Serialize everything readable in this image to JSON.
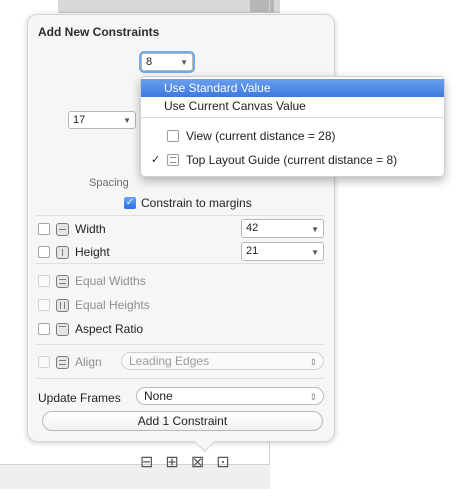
{
  "title": "Add New Constraints",
  "spacing": {
    "top_value": "8",
    "left_value": "17",
    "label": "Spacing"
  },
  "menu": {
    "items": [
      "Use Standard Value",
      "Use Current Canvas Value",
      "View (current distance = 28)",
      "Top Layout Guide (current distance = 8)"
    ],
    "checked_mark": "✓"
  },
  "constrain_to_margins": "Constrain to margins",
  "constraints": {
    "width_label": "Width",
    "width_value": "42",
    "height_label": "Height",
    "height_value": "21",
    "equal_widths_label": "Equal Widths",
    "equal_heights_label": "Equal Heights",
    "aspect_ratio_label": "Aspect Ratio",
    "align_label": "Align",
    "align_value": "Leading Edges"
  },
  "update_frames": {
    "label": "Update Frames",
    "value": "None"
  },
  "add_button": "Add 1 Constraint",
  "toolbar_icons": [
    "align-icon",
    "pin-icon",
    "resolve-icon",
    "resize-icon"
  ],
  "colors": {
    "menu_highlight": "#3d78df",
    "focus_ring": "#75a9ea",
    "check_blue": "#2c6fe2"
  }
}
